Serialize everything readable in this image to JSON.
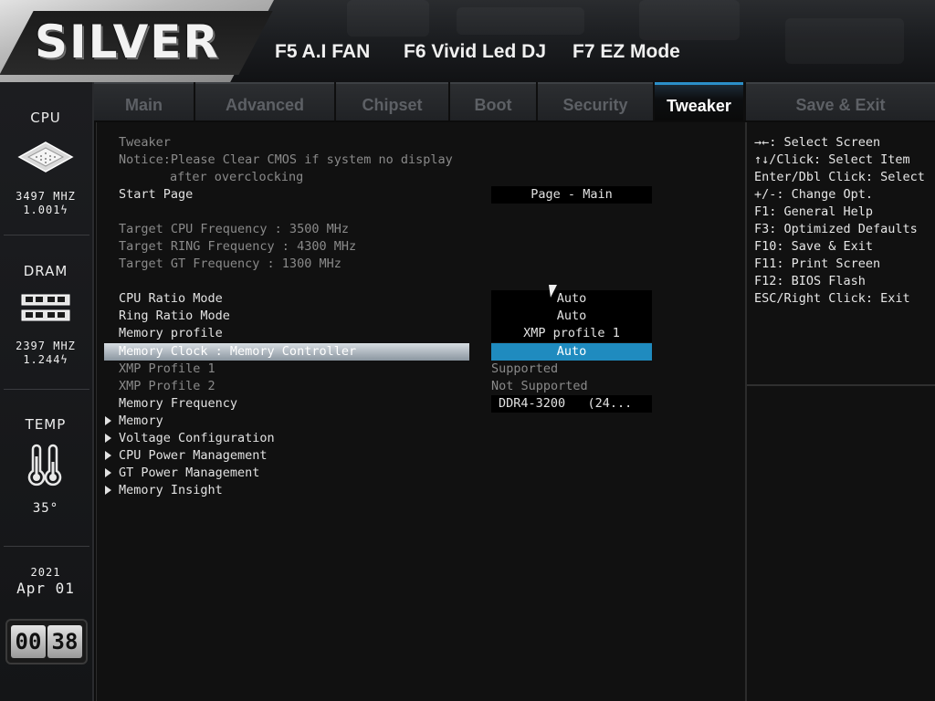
{
  "header": {
    "logo": "SILVER",
    "fkeys": [
      "F5 A.I FAN",
      "F6 Vivid Led DJ",
      "F7 EZ Mode"
    ]
  },
  "sidebar": {
    "cpu": {
      "title": "CPU",
      "freq": "3497 MHZ",
      "volt": "1.001ϟ"
    },
    "dram": {
      "title": "DRAM",
      "freq": "2397 MHZ",
      "volt": "1.244ϟ"
    },
    "temp": {
      "title": "TEMP",
      "value": "35°"
    },
    "date": {
      "year": "2021",
      "monthday": "Apr 01"
    },
    "clock": {
      "hours": "00",
      "minutes": "38"
    }
  },
  "tabs": [
    {
      "label": "Main",
      "active": false
    },
    {
      "label": "Advanced",
      "active": false
    },
    {
      "label": "Chipset",
      "active": false
    },
    {
      "label": "Boot",
      "active": false
    },
    {
      "label": "Security",
      "active": false
    },
    {
      "label": "Tweaker",
      "active": true
    },
    {
      "label": "Save & Exit",
      "active": false
    }
  ],
  "main": {
    "section_title": "Tweaker",
    "notice_line1": "Notice:Please Clear CMOS if system no display",
    "notice_line2": "after overclocking",
    "start_page": {
      "label": "Start Page",
      "value": "Page - Main"
    },
    "targets": [
      "Target CPU Frequency : 3500 MHz",
      "Target RING Frequency : 4300 MHz",
      "Target GT Frequency : 1300 MHz"
    ],
    "settings": [
      {
        "label": "CPU Ratio Mode",
        "value": "Auto"
      },
      {
        "label": "Ring Ratio Mode",
        "value": "Auto"
      },
      {
        "label": "Memory profile",
        "value": "XMP profile 1"
      },
      {
        "label": "Memory Clock : Memory Controller",
        "value": "Auto"
      },
      {
        "label": "XMP Profile 1",
        "value": "Supported"
      },
      {
        "label": "XMP Profile 2",
        "value": "Not Supported"
      },
      {
        "label": "Memory Frequency",
        "value": "DDR4-3200   (24..."
      }
    ],
    "submenus": [
      "Memory",
      "Voltage Configuration",
      "CPU Power Management",
      "GT Power Management",
      "Memory Insight"
    ]
  },
  "help": [
    "→←: Select Screen",
    "↑↓/Click: Select Item",
    "Enter/Dbl Click: Select",
    "+/-: Change Opt.",
    "F1: General Help",
    "F3: Optimized Defaults",
    "F10: Save & Exit",
    "F11: Print Screen",
    "F12: BIOS Flash",
    "ESC/Right Click: Exit"
  ],
  "colors": {
    "accent": "#2b8fc9",
    "selected_value": "#1f8bbf",
    "background": "#111111"
  }
}
